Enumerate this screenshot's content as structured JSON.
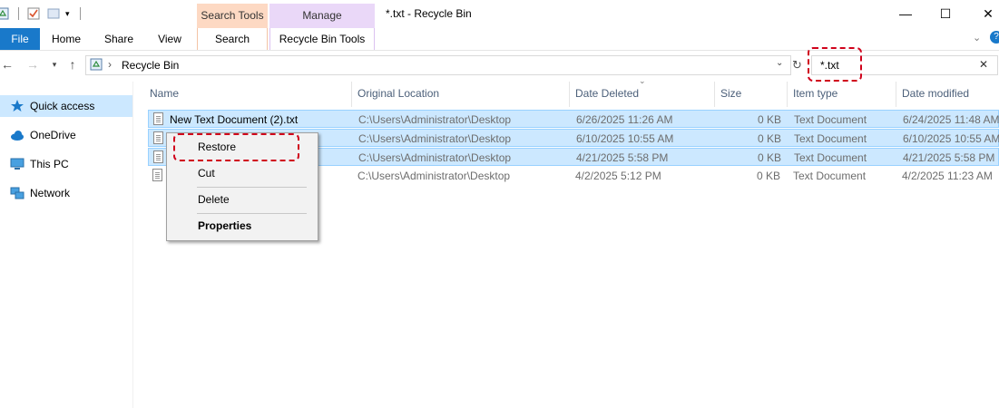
{
  "window": {
    "title": "*.txt - Recycle Bin",
    "contextual_tabs": [
      "Search Tools",
      "Manage"
    ],
    "contextual_subtabs": [
      "Search",
      "Recycle Bin Tools"
    ],
    "controls": {
      "minimize": "—",
      "maximize": "☐",
      "close": "✕"
    }
  },
  "ribbon": {
    "tabs": [
      "File",
      "Home",
      "Share",
      "View"
    ],
    "file_color": "#1979ca",
    "search_tools_color": "#fdd9c3",
    "manage_color": "#ead8f8"
  },
  "address": {
    "path": "Recycle Bin",
    "separator": "›"
  },
  "search": {
    "value": "*.txt"
  },
  "nav": {
    "items": [
      "Quick access",
      "OneDrive",
      "This PC",
      "Network"
    ]
  },
  "columns": [
    "Name",
    "Original Location",
    "Date Deleted",
    "Size",
    "Item type",
    "Date modified"
  ],
  "rows": [
    {
      "name": "New Text Document (2).txt",
      "location": "C:\\Users\\Administrator\\Desktop",
      "deleted": "6/26/2025 11:26 AM",
      "size": "0 KB",
      "type": "Text Document",
      "modified": "6/24/2025 11:48 AM",
      "selected": true
    },
    {
      "name": "",
      "location": "C:\\Users\\Administrator\\Desktop",
      "deleted": "6/10/2025 10:55 AM",
      "size": "0 KB",
      "type": "Text Document",
      "modified": "6/10/2025 10:55 AM",
      "selected": true
    },
    {
      "name": "",
      "location": "C:\\Users\\Administrator\\Desktop",
      "deleted": "4/21/2025 5:58 PM",
      "size": "0 KB",
      "type": "Text Document",
      "modified": "4/21/2025 5:58 PM",
      "selected": true
    },
    {
      "name": "",
      "location": "C:\\Users\\Administrator\\Desktop",
      "deleted": "4/2/2025 5:12 PM",
      "size": "0 KB",
      "type": "Text Document",
      "modified": "4/2/2025 11:23 AM",
      "selected": false
    }
  ],
  "context_menu": {
    "restore": "Restore",
    "cut": "Cut",
    "delete": "Delete",
    "properties": "Properties"
  },
  "highlight_color": "#d0021b"
}
